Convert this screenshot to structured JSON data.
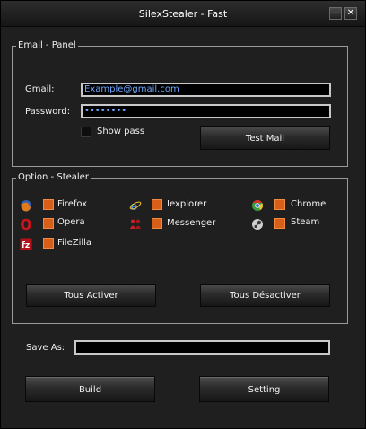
{
  "window": {
    "title": "SilexStealer - Fast"
  },
  "email_panel": {
    "legend": "Email - Panel",
    "gmail_label": "Gmail:",
    "gmail_value": "Example@gmail.com",
    "password_label": "Password:",
    "password_value": "••••••••",
    "show_pass_label": "Show pass",
    "test_mail_label": "Test Mail"
  },
  "options": {
    "legend": "Option - Stealer",
    "items": [
      {
        "label": "Firefox",
        "icon": "firefox-icon"
      },
      {
        "label": "Opera",
        "icon": "opera-icon"
      },
      {
        "label": "FileZilla",
        "icon": "filezilla-icon"
      },
      {
        "label": "Iexplorer",
        "icon": "internet-explorer-icon"
      },
      {
        "label": "Messenger",
        "icon": "messenger-icon"
      },
      {
        "label": "Chrome",
        "icon": "chrome-icon"
      },
      {
        "label": "Steam",
        "icon": "steam-icon"
      }
    ],
    "enable_all_label": "Tous Activer",
    "disable_all_label": "Tous Désactiver"
  },
  "save": {
    "label": "Save As:",
    "value": ""
  },
  "actions": {
    "build_label": "Build",
    "setting_label": "Setting"
  },
  "colors": {
    "accent": "#d75f1a",
    "background": "#1f1f1f",
    "input_text": "#6fa8ff"
  }
}
